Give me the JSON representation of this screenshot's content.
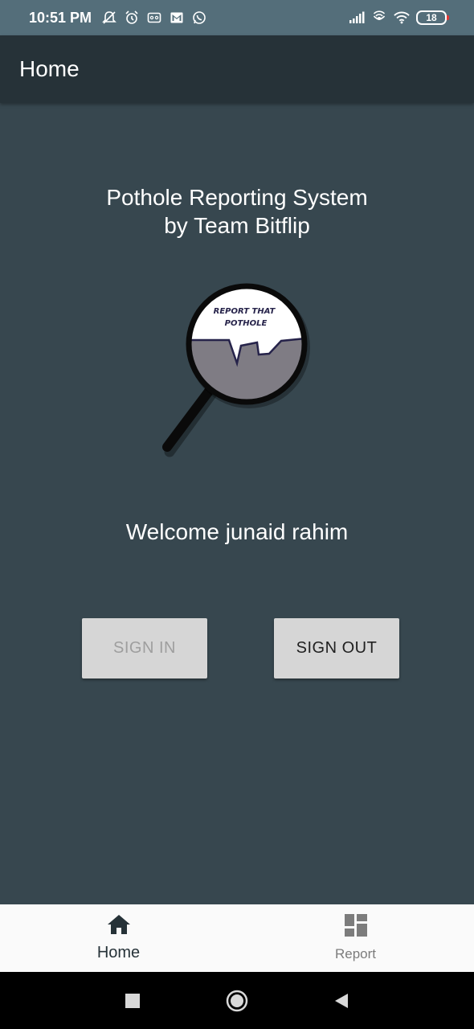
{
  "status_bar": {
    "time": "10:51 PM",
    "battery": "18",
    "left_icons": [
      "mute-icon",
      "alarm-icon",
      "voicemail-icon",
      "gmail-icon",
      "whatsapp-icon"
    ],
    "right_icons": [
      "signal-icon",
      "hotspot-icon",
      "wifi-icon",
      "battery-icon"
    ]
  },
  "app_bar": {
    "title": "Home"
  },
  "main": {
    "headline_line1": "Pothole Reporting System",
    "headline_line2": "by Team Bitflip",
    "logo_text_line1": "REPORT THAT",
    "logo_text_line2": "POTHOLE",
    "welcome": "Welcome junaid rahim",
    "sign_in_label": "SIGN IN",
    "sign_out_label": "SIGN OUT"
  },
  "bottom_nav": {
    "items": [
      {
        "label": "Home",
        "icon": "home-icon",
        "active": true
      },
      {
        "label": "Report",
        "icon": "dashboard-icon",
        "active": false
      }
    ]
  },
  "system_nav": {
    "icons": [
      "recents-icon",
      "home-circle-icon",
      "back-icon"
    ]
  },
  "colors": {
    "background": "#37474f",
    "app_bar": "#263238",
    "status_bar": "#546e7a",
    "button": "#d6d6d6",
    "nav_bg": "#fafafa"
  }
}
